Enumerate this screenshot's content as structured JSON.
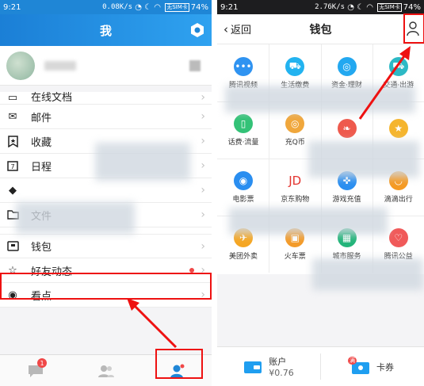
{
  "left": {
    "status": {
      "time": "9:21",
      "net": "0.08K/s",
      "sim": "无SIM卡",
      "battery": "74%"
    },
    "header": {
      "title": "我"
    },
    "menu": [
      {
        "label": "在线文档",
        "icon": "document-icon"
      },
      {
        "label": "邮件",
        "icon": "mail-icon"
      },
      {
        "label": "收藏",
        "icon": "bookmark-icon"
      },
      {
        "label": "日程",
        "icon": "calendar-icon"
      },
      {
        "label": "",
        "icon": "blurred-icon"
      },
      {
        "label": "文件",
        "icon": "folder-icon"
      },
      {
        "label": "钱包",
        "icon": "wallet-icon"
      },
      {
        "label": "好友动态",
        "icon": "star-icon"
      },
      {
        "label": "看点",
        "icon": "eye-icon"
      }
    ],
    "tabbar": {
      "badge": "1"
    }
  },
  "right": {
    "status": {
      "time": "9:21",
      "net": "2.76K/s",
      "sim": "无SIM卡",
      "battery": "74%"
    },
    "header": {
      "back": "返回",
      "title": "钱包"
    },
    "services": [
      {
        "label": "腾讯视频",
        "color": "#2f93f1",
        "icon": "chat-icon"
      },
      {
        "label": "生活缴费",
        "color": "#22b3f0",
        "icon": "cart-icon"
      },
      {
        "label": "资金·理财",
        "color": "#23a8f0",
        "icon": "piggy-icon"
      },
      {
        "label": "交通·出游",
        "color": "#2db9c5",
        "icon": "car-icon"
      },
      {
        "label": "话费·流量",
        "color": "#33c277",
        "icon": "phone-icon"
      },
      {
        "label": "充Q币",
        "color": "#f0a73c",
        "icon": "coin-icon"
      },
      {
        "label": "",
        "color": "#ee5a4d",
        "icon": "leaf-icon"
      },
      {
        "label": "",
        "color": "#f5b52e",
        "icon": "star-badge-icon"
      },
      {
        "label": "电影票",
        "color": "#2a8ef0",
        "icon": "film-icon"
      },
      {
        "label": "京东购物",
        "color": "#e3342f",
        "icon": "jd-icon"
      },
      {
        "label": "游戏充值",
        "color": "#2a8ef0",
        "icon": "gamepad-icon"
      },
      {
        "label": "滴滴出行",
        "color": "#f59a23",
        "icon": "didi-icon"
      },
      {
        "label": "美团外卖",
        "color": "#f5a623",
        "icon": "plane-icon"
      },
      {
        "label": "火车票",
        "color": "#f39b2a",
        "icon": "train-icon"
      },
      {
        "label": "城市服务",
        "color": "#23b47a",
        "icon": "building-icon"
      },
      {
        "label": "腾讯公益",
        "color": "#f05a5a",
        "icon": "heart-icon"
      }
    ],
    "account": {
      "label": "账户",
      "value": "¥0.76"
    },
    "coupon": {
      "label": "卡券",
      "badge": "满"
    }
  }
}
